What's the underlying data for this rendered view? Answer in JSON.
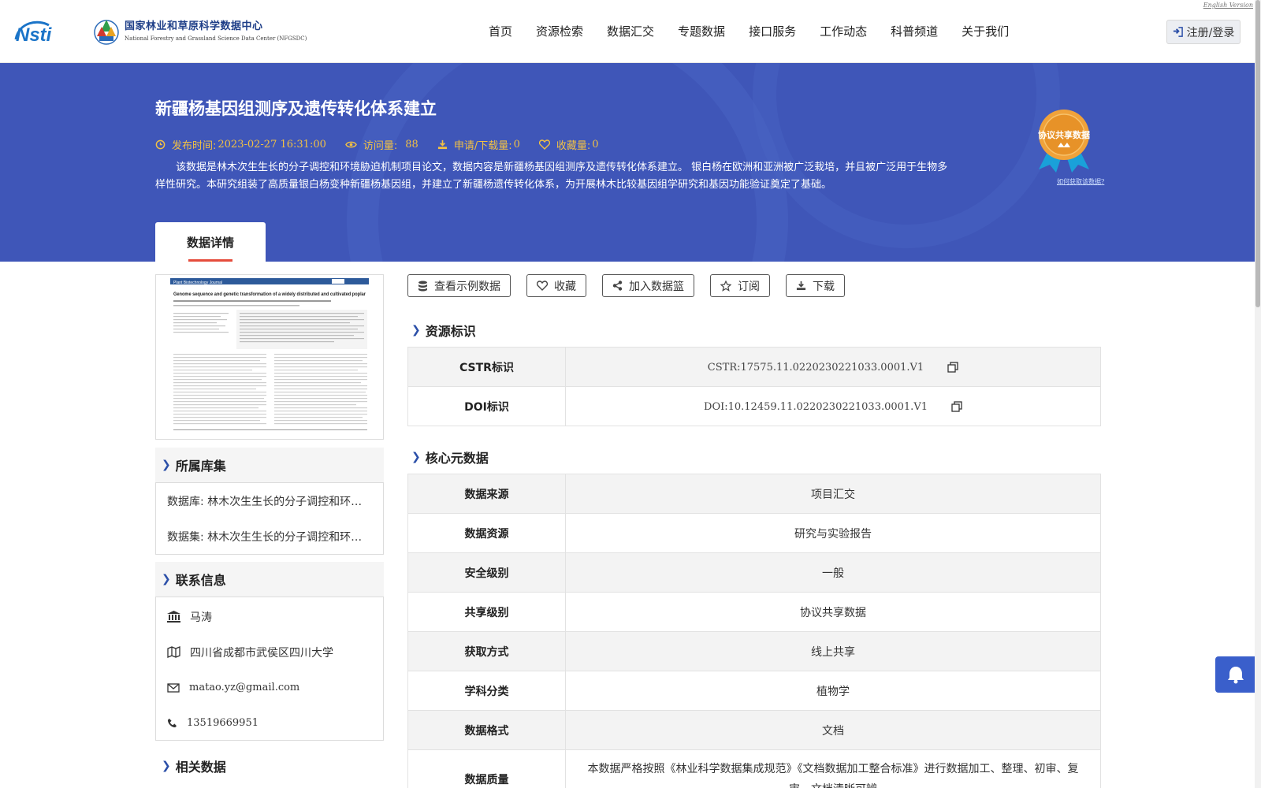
{
  "header": {
    "logo_text": "Nsti",
    "center_name_cn": "国家林业和草原科学数据中心",
    "center_name_en": "National Forestry and Grassland Science Data Center (NFGSDC)",
    "english_link": "English Version",
    "login_label": "注册/登录",
    "nav": [
      "首页",
      "资源检索",
      "数据汇交",
      "专题数据",
      "接口服务",
      "工作动态",
      "科普频道",
      "关于我们"
    ]
  },
  "banner": {
    "title": "新疆杨基因组测序及遗传转化体系建立",
    "publish_label": "发布时间:",
    "publish_value": "2023-02-27 16:31:00",
    "views_label": "访问量:",
    "views_value": "88",
    "downloads_label": "申请/下载量:",
    "downloads_value": "0",
    "favorites_label": "收藏量:",
    "favorites_value": "0",
    "description": "该数据是林木次生生长的分子调控和环境胁迫机制项目论文，数据内容是新疆杨基因组测序及遗传转化体系建立。 银白杨在欧洲和亚洲被广泛栽培，并且被广泛用于生物多样性研究。本研究组装了高质量银白杨变种新疆杨基因组，并建立了新疆杨遗传转化体系，为开展林木比较基因组学研究和基因功能验证奠定了基础。",
    "tab_label": "数据详情",
    "badge_label": "协议共享数据",
    "badge_link": "如何获取该数据?"
  },
  "sidebar": {
    "thumbnail_journal": "Plant Biotechnology Journal",
    "thumbnail_title": "Genome sequence and genetic transformation of a widely distributed and cultivated poplar",
    "collection_heading": "所属库集",
    "collections": [
      "数据库: 林木次生生长的分子调控和环境胁迫机制",
      "数据集: 林木次生生长的分子调控和环境胁迫机制"
    ],
    "contact_heading": "联系信息",
    "contact": {
      "name": "马涛",
      "address": "四川省成都市武侯区四川大学",
      "email": "matao.yz@gmail.com",
      "phone": "13519669951"
    },
    "related_heading": "相关数据"
  },
  "actions": [
    "查看示例数据",
    "收藏",
    "加入数据篮",
    "订阅",
    "下载"
  ],
  "resource_id": {
    "heading": "资源标识",
    "rows": [
      {
        "key": "CSTR标识",
        "value": "CSTR:17575.11.0220230221033.0001.V1"
      },
      {
        "key": "DOI标识",
        "value": "DOI:10.12459.11.0220230221033.0001.V1"
      }
    ]
  },
  "core_meta": {
    "heading": "核心元数据",
    "rows": [
      {
        "key": "数据来源",
        "value": "项目汇交"
      },
      {
        "key": "数据资源",
        "value": "研究与实验报告"
      },
      {
        "key": "安全级别",
        "value": "一般"
      },
      {
        "key": "共享级别",
        "value": "协议共享数据"
      },
      {
        "key": "获取方式",
        "value": "线上共享"
      },
      {
        "key": "学科分类",
        "value": "植物学"
      },
      {
        "key": "数据格式",
        "value": "文档"
      },
      {
        "key": "数据质量",
        "value": "本数据严格按照《林业科学数据集成规范》《文档数据加工整合标准》进行数据加工、整理、初审、复审、文档清晰可辨"
      }
    ]
  },
  "colors": {
    "banner": "#3f56b8",
    "meta_gold": "#f2c144",
    "accent_red": "#e54c3c",
    "chevron_blue": "#2b4fa8"
  }
}
